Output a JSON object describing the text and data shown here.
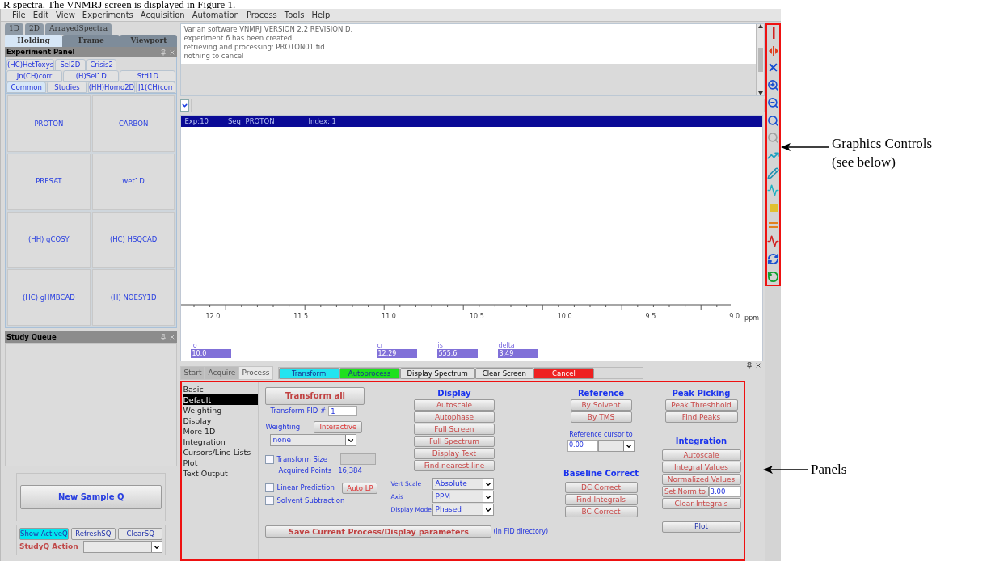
{
  "document_text": "R spectra.  The VNMRJ screen is displayed in Figure 1.",
  "menu": [
    "File",
    "Edit",
    "View",
    "Experiments",
    "Acquisition",
    "Automation",
    "Process",
    "Tools",
    "Help"
  ],
  "viewport_tabs": [
    {
      "label": "1D",
      "selected": false
    },
    {
      "label": "2D",
      "selected": false
    },
    {
      "label": "ArrayedSpectra",
      "selected": false
    }
  ],
  "holding_tabs": [
    {
      "label": "Holding",
      "selected": true
    },
    {
      "label": "Frame",
      "selected": false
    },
    {
      "label": "Viewport",
      "selected": false
    }
  ],
  "experiment_panel": {
    "title": "Experiment Panel",
    "tab_rows": [
      [
        {
          "label": "(HC)HetToxys",
          "selected": false
        },
        {
          "label": "Sel2D",
          "selected": false
        },
        {
          "label": "Crisis2",
          "selected": false
        }
      ],
      [
        {
          "label": "Jn(CH)corr",
          "selected": false
        },
        {
          "label": "(H)Sel1D",
          "selected": false
        },
        {
          "label": "Std1D",
          "selected": false
        }
      ],
      [
        {
          "label": "Common",
          "selected": true
        },
        {
          "label": "Studies",
          "selected": false
        },
        {
          "label": "(HH)Homo2D",
          "selected": false
        },
        {
          "label": "J1(CH)corr",
          "selected": false
        }
      ]
    ],
    "experiments": [
      "PROTON",
      "CARBON",
      "PRESAT",
      "wet1D",
      "(HH) gCOSY",
      "(HC) HSQCAD",
      "(HC) gHMBCAD",
      "(H) NOESY1D"
    ]
  },
  "study_queue": {
    "title": "Study Queue",
    "new_sample_button": "New Sample Q",
    "buttons": [
      {
        "label": "Show ActiveQ",
        "color": "#00e5ee"
      },
      {
        "label": "RefreshSQ",
        "color": "#e4e4e4"
      },
      {
        "label": "ClearSQ",
        "color": "#e4e4e4"
      }
    ],
    "action_label": "StudyQ Action"
  },
  "output_lines": [
    "Varian software VNMRJ VERSION 2.2 REVISION D.",
    "experiment 6 has been created",
    "retrieving and processing: PROTON01.fid",
    "nothing to cancel"
  ],
  "spectrum": {
    "header": [
      "Exp:10",
      "Seq: PROTON",
      "Index: 1"
    ],
    "axis_labels": [
      "12.0",
      "11.5",
      "11.0",
      "10.5",
      "10.0",
      "9.5",
      "9.0"
    ],
    "axis_unit": "ppm",
    "parameters": [
      {
        "name": "io",
        "value": "10.0"
      },
      {
        "name": "cr",
        "value": "12.29"
      },
      {
        "name": "is",
        "value": "555.6"
      },
      {
        "name": "delta",
        "value": "3.49"
      }
    ]
  },
  "process_tabs": [
    {
      "label": "Start",
      "selected": false
    },
    {
      "label": "Acquire",
      "selected": false
    },
    {
      "label": "Process",
      "selected": true
    }
  ],
  "action_buttons": [
    {
      "label": "Transform",
      "color": "#22e4f0"
    },
    {
      "label": "Autoprocess",
      "color": "#1ee01e"
    },
    {
      "label": "Display Spectrum",
      "color": "#e4e4e4"
    },
    {
      "label": "Clear Screen",
      "color": "#e4e4e4"
    },
    {
      "label": "Cancel",
      "color": "#ee2020"
    }
  ],
  "panel_list": [
    {
      "label": "Basic",
      "selected": false
    },
    {
      "label": "Default",
      "selected": true
    },
    {
      "label": "Weighting",
      "selected": false
    },
    {
      "label": "Display",
      "selected": false
    },
    {
      "label": "More 1D",
      "selected": false
    },
    {
      "label": "Integration",
      "selected": false
    },
    {
      "label": "Cursors/Line Lists",
      "selected": false
    },
    {
      "label": "Plot",
      "selected": false
    },
    {
      "label": "Text Output",
      "selected": false
    }
  ],
  "process_panel": {
    "transform_all": "Transform all",
    "transform_fid": {
      "label": "Transform FID #",
      "value": "1"
    },
    "weighting": {
      "label": "Weighting",
      "button": "Interactive",
      "value": "none"
    },
    "transform_size": {
      "label": "Transform Size",
      "checked": false
    },
    "acquired_points": {
      "label": "Acquired Points",
      "value": "16,384"
    },
    "linear_prediction": {
      "label": "Linear Prediction",
      "checked": false,
      "button": "Auto LP"
    },
    "solvent_subtraction": {
      "label": "Solvent Subtraction",
      "checked": false
    },
    "save_button": "Save Current Process/Display parameters",
    "save_note": "(in FID directory)",
    "display": {
      "title": "Display",
      "buttons": [
        "Autoscale",
        "Autophase",
        "Full Screen",
        "Full Spectrum",
        "Display Text",
        "Find nearest line"
      ]
    },
    "display_options": [
      {
        "label": "Vert Scale",
        "value": "Absolute"
      },
      {
        "label": "Axis",
        "value": "PPM"
      },
      {
        "label": "Display Mode",
        "value": "Phased"
      }
    ],
    "reference": {
      "title": "Reference",
      "buttons": [
        "By Solvent",
        "By TMS"
      ],
      "cursor_label": "Reference cursor to",
      "cursor_value": "0.00"
    },
    "baseline": {
      "title": "Baseline Correct",
      "buttons": [
        "DC Correct",
        "Find Integrals",
        "BC Correct"
      ]
    },
    "peak_picking": {
      "title": "Peak Picking",
      "buttons": [
        "Peak Threshhold",
        "Find Peaks"
      ]
    },
    "integration": {
      "title": "Integration",
      "buttons": [
        "Autoscale",
        "Integral Values",
        "Normalized Values"
      ],
      "norm_button": "Set Norm to",
      "norm_value": "3.00",
      "clear_button": "Clear Integrals"
    },
    "plot_button": "Plot"
  },
  "annotations": [
    {
      "kind": "graphics",
      "lines": [
        "Graphics Controls",
        "(see below)"
      ]
    },
    {
      "kind": "panels",
      "lines": [
        "Panels"
      ]
    }
  ]
}
